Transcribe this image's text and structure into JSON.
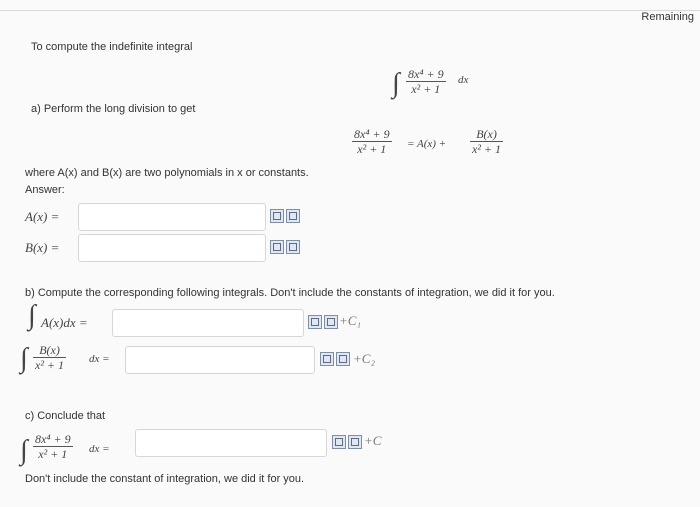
{
  "header": {
    "remaining": "Remaining"
  },
  "intro": "To compute the indefinite integral",
  "integral": {
    "num": "8x⁴ + 9",
    "den": "x² + 1",
    "dx": "dx"
  },
  "part_a": {
    "label": "a) Perform the long division to get",
    "eq": {
      "num": "8x⁴ + 9",
      "den": "x² + 1",
      "mid": "= A(x) +",
      "rnum": "B(x)",
      "rden": "x² + 1"
    },
    "note": "where A(x) and B(x) are two polynomials in x or constants.",
    "answer_label": "Answer:",
    "A_label": "A(x) =",
    "B_label": "B(x) ="
  },
  "part_b": {
    "label": "b) Compute the corresponding following integrals. Don't include the constants of integration, we did it for you.",
    "int1_expr": "A(x)dx =",
    "c1": "+C₁",
    "int2_num": "B(x)",
    "int2_den": "x² + 1",
    "int2_tail": "dx =",
    "c2": "+C₂"
  },
  "part_c": {
    "label": "c) Conclude that",
    "num": "8x⁴ + 9",
    "den": "x² + 1",
    "tail": "dx =",
    "c": "+C",
    "footer": "Don't include the constant of integration, we did it for you."
  }
}
